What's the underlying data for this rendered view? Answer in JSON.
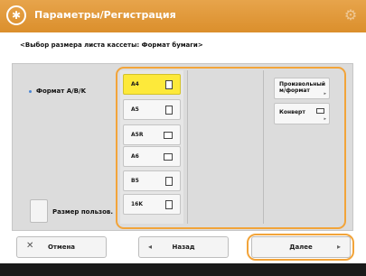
{
  "header": {
    "title": "Параметры/Регистрация",
    "left_icon": "asterisk-gear-icon",
    "right_icon": "settings-gear-icon",
    "accent_color": "#e29a3c"
  },
  "subtitle": "<Выбор размера листа кассеты: Формат бумаги>",
  "panel": {
    "format_label": "Формат A/B/K",
    "size_label": "Размер пользов.",
    "paper_sizes": [
      {
        "label": "A4",
        "selected": true,
        "icon": "portrait-paper-icon"
      },
      {
        "label": "A5",
        "selected": false,
        "icon": "portrait-paper-icon"
      },
      {
        "label": "A5R",
        "selected": false,
        "icon": "landscape-paper-icon"
      },
      {
        "label": "A6",
        "selected": false,
        "icon": "landscape-paper-icon"
      },
      {
        "label": "B5",
        "selected": false,
        "icon": "portrait-paper-icon"
      },
      {
        "label": "16K",
        "selected": false,
        "icon": "portrait-paper-icon"
      }
    ],
    "side_buttons": [
      {
        "line1": "Произвольный",
        "line2": "м/формат"
      },
      {
        "line1": "Конверт",
        "line2": ""
      }
    ]
  },
  "footer": {
    "cancel_label": "Отмена",
    "back_label": "Назад",
    "next_label": "Далее"
  }
}
